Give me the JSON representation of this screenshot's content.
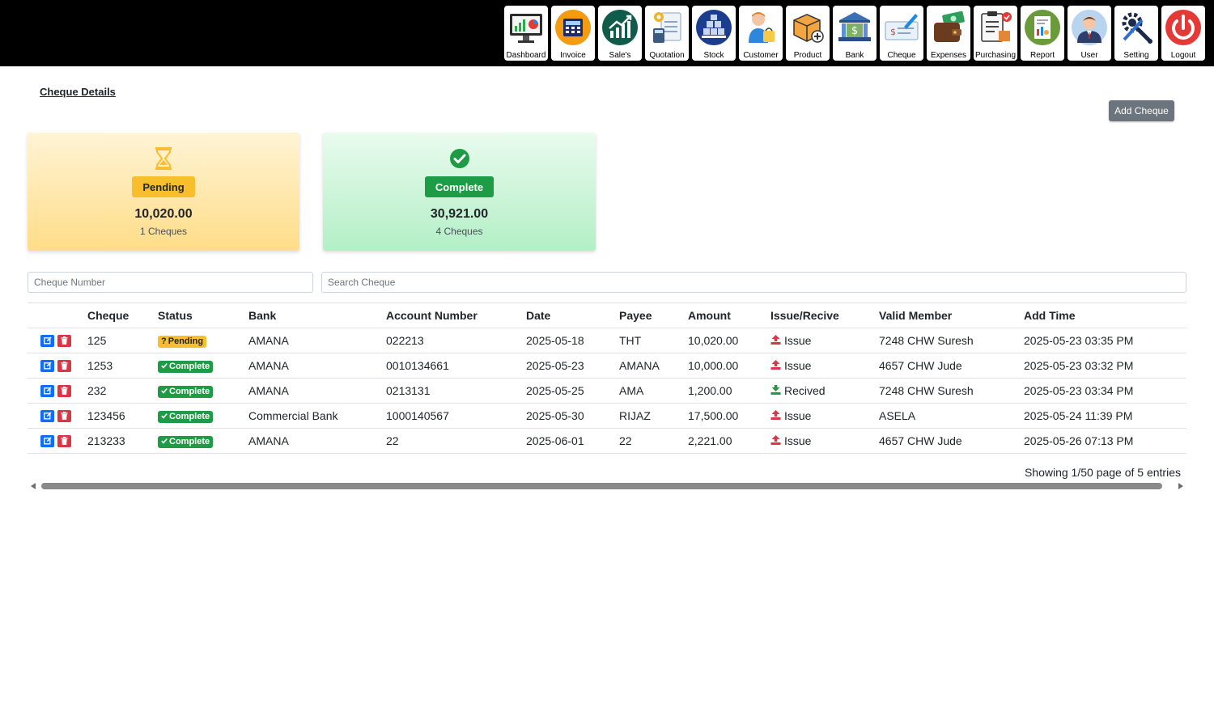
{
  "nav": [
    {
      "label": "Dashboard",
      "icon": "dashboard-icon"
    },
    {
      "label": "Invoice",
      "icon": "invoice-icon"
    },
    {
      "label": "Sale's",
      "icon": "sales-icon"
    },
    {
      "label": "Quotation",
      "icon": "quotation-icon"
    },
    {
      "label": "Stock",
      "icon": "stock-icon"
    },
    {
      "label": "Customer",
      "icon": "customer-icon"
    },
    {
      "label": "Product",
      "icon": "product-icon"
    },
    {
      "label": "Bank",
      "icon": "bank-icon"
    },
    {
      "label": "Cheque",
      "icon": "cheque-icon"
    },
    {
      "label": "Expenses",
      "icon": "expenses-icon"
    },
    {
      "label": "Purchasing",
      "icon": "purchasing-icon"
    },
    {
      "label": "Report",
      "icon": "report-icon"
    },
    {
      "label": "User",
      "icon": "user-icon"
    },
    {
      "label": "Setting",
      "icon": "setting-icon"
    },
    {
      "label": "Logout",
      "icon": "logout-icon"
    }
  ],
  "page": {
    "title": "Cheque Details",
    "add_button": "Add Cheque"
  },
  "summary": {
    "pending": {
      "label": "Pending",
      "amount": "10,020.00",
      "count": "1 Cheques",
      "icon": "hourglass-icon",
      "color": "#f9be2c"
    },
    "complete": {
      "label": "Complete",
      "amount": "30,921.00",
      "count": "4 Cheques",
      "icon": "check-circle-icon",
      "color": "#1e9c45"
    }
  },
  "filters": {
    "cheque_number_placeholder": "Cheque Number",
    "search_placeholder": "Search Cheque"
  },
  "table": {
    "columns": [
      "",
      "Cheque",
      "Status",
      "Bank",
      "Account Number",
      "Date",
      "Payee",
      "Amount",
      "Issue/Recive",
      "Valid Member",
      "Add Time"
    ],
    "rows": [
      {
        "cheque": "125",
        "status": "Pending",
        "bank": "AMANA",
        "account": "022213",
        "date": "2025-05-18",
        "payee": "THT",
        "amount": "10,020.00",
        "direction": "Issue",
        "member": "7248 CHW Suresh",
        "added": "2025-05-23 03:35 PM"
      },
      {
        "cheque": "1253",
        "status": "Complete",
        "bank": "AMANA",
        "account": "0010134661",
        "date": "2025-05-23",
        "payee": "AMANA",
        "amount": "10,000.00",
        "direction": "Issue",
        "member": "4657 CHW Jude",
        "added": "2025-05-23 03:32 PM"
      },
      {
        "cheque": "232",
        "status": "Complete",
        "bank": "AMANA",
        "account": "0213131",
        "date": "2025-05-25",
        "payee": "AMA",
        "amount": "1,200.00",
        "direction": "Recived",
        "member": "7248 CHW Suresh",
        "added": "2025-05-23 03:34 PM"
      },
      {
        "cheque": "123456",
        "status": "Complete",
        "bank": "Commercial Bank",
        "account": "1000140567",
        "date": "2025-05-30",
        "payee": "RIJAZ",
        "amount": "17,500.00",
        "direction": "Issue",
        "member": "ASELA",
        "added": "2025-05-24 11:39 PM"
      },
      {
        "cheque": "213233",
        "status": "Complete",
        "bank": "AMANA",
        "account": "22",
        "date": "2025-06-01",
        "payee": "22",
        "amount": "2,221.00",
        "direction": "Issue",
        "member": "4657 CHW Jude",
        "added": "2025-05-26 07:13 PM"
      }
    ]
  },
  "pagination": {
    "summary": "Showing 1/50 page of 5 entries"
  },
  "colors": {
    "issue": "#dc3545",
    "received": "#1e9c45",
    "edit": "#0d6efd",
    "delete": "#dc3545"
  }
}
